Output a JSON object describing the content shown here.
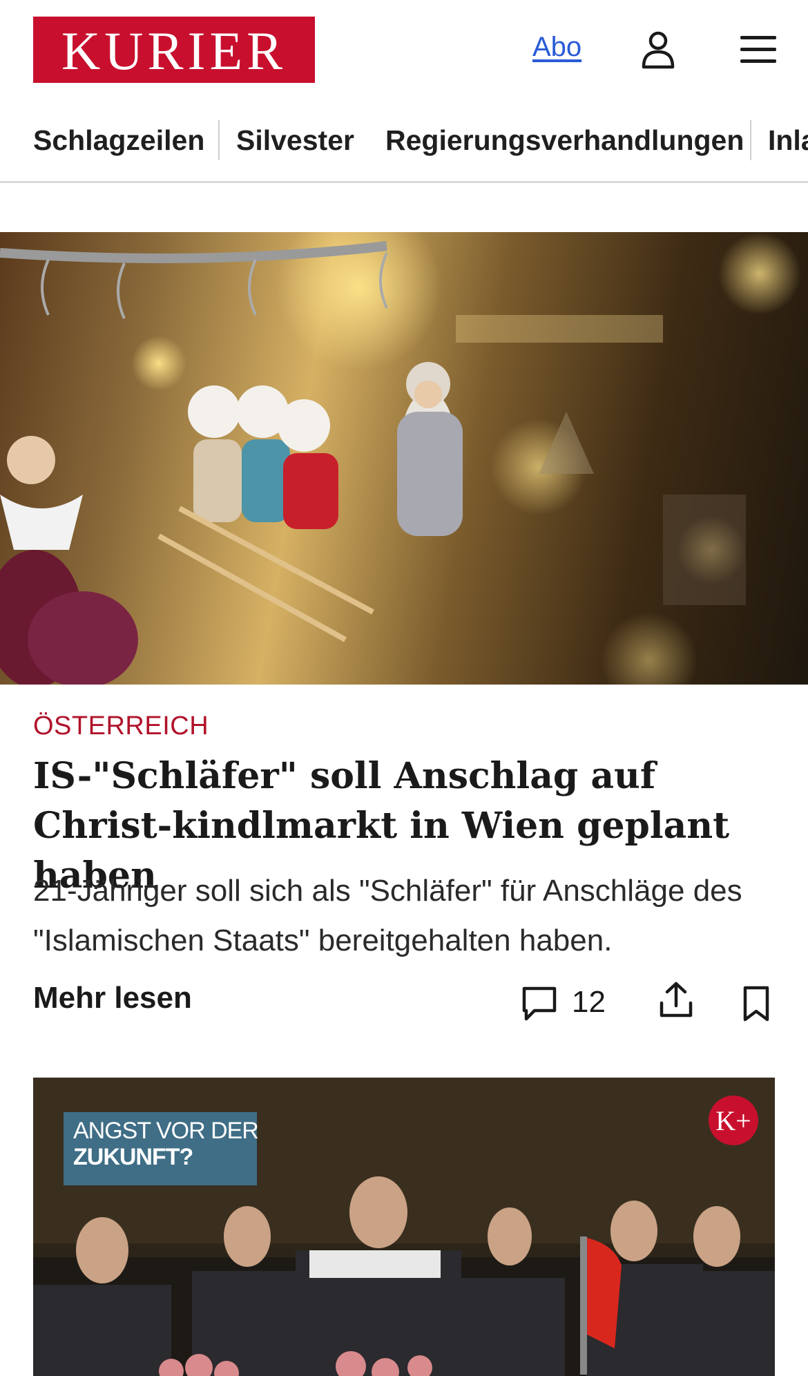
{
  "header": {
    "logo_text": "KURIER",
    "abo_label": "Abo",
    "icons": [
      "user-icon",
      "menu-icon"
    ]
  },
  "nav": {
    "items": [
      {
        "label": "Schlagzeilen"
      },
      {
        "label": "Silvester"
      },
      {
        "label": "Regierungsverhandlungen"
      },
      {
        "label": "Inla"
      }
    ]
  },
  "article1": {
    "kicker": "ÖSTERREICH",
    "headline": "IS-\"Schläfer\" soll Anschlag auf Christ-kindlmarkt in Wien geplant haben",
    "teaser": "21-Jähriger soll sich als \"Schläfer\" für Anschläge des \"Islamischen Staats\" bereitgehalten haben.",
    "more_label": "Mehr lesen",
    "comment_count": "12",
    "icons": [
      "comment-icon",
      "share-icon",
      "bookmark-icon"
    ]
  },
  "article2": {
    "badge_line1": "ANGST VOR DER",
    "badge_line2": "ZUKUNFT?",
    "premium_badge": "K+"
  },
  "colors": {
    "brand_red": "#c8102e",
    "kicker_red": "#b0132a",
    "link_blue": "#2a5bd7"
  }
}
